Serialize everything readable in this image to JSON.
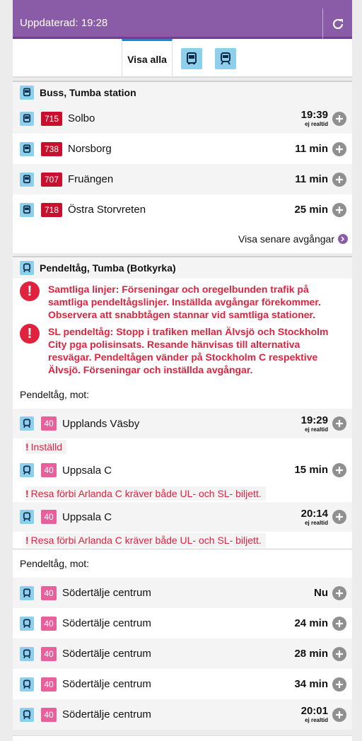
{
  "header": {
    "title": "Uppdaterad: 19:28"
  },
  "tabs": {
    "all_label": "Visa alla"
  },
  "bus_section": {
    "title": "Buss, Tumba station",
    "departures": [
      {
        "line": "715",
        "dest": "Solbo",
        "time": "19:39",
        "sub": "ej realtid"
      },
      {
        "line": "738",
        "dest": "Norsborg",
        "time": "11 min",
        "sub": ""
      },
      {
        "line": "707",
        "dest": "Fruängen",
        "time": "11 min",
        "sub": ""
      },
      {
        "line": "718",
        "dest": "Östra Storvreten",
        "time": "25 min",
        "sub": ""
      }
    ],
    "more_label": "Visa senare avgångar"
  },
  "train_section": {
    "title": "Pendeltåg, Tumba (Botkyrka)",
    "alerts": [
      "Samtliga linjer: Förseningar och oregelbunden trafik på samtliga pendeltågslinjer. Inställda avgångar förekommer. Observera att snabbtågen stannar vid samtliga stationer.",
      "SL pendeltåg: Stopp i trafiken mellan Älvsjö och Stockholm City pga polisinsats. Resande hänvisas till alternativa resvägar. Pendeltågen vänder på Stockholm C respektive Älvsjö. Förseningar och inställda avgångar."
    ],
    "group1_label": "Pendeltåg, mot:",
    "group1": [
      {
        "line": "40",
        "dest": "Upplands Väsby",
        "time": "19:29",
        "sub": "ej realtid",
        "note": "Inställd"
      },
      {
        "line": "40",
        "dest": "Uppsala C",
        "time": "15 min",
        "sub": "",
        "note": "Resa förbi Arlanda C kräver både UL- och SL- biljett."
      },
      {
        "line": "40",
        "dest": "Uppsala C",
        "time": "20:14",
        "sub": "ej realtid",
        "note": "Resa förbi Arlanda C kräver både UL- och SL- biljett."
      }
    ],
    "group2_label": "Pendeltåg, mot:",
    "group2": [
      {
        "line": "40",
        "dest": "Södertälje centrum",
        "time": "Nu",
        "sub": ""
      },
      {
        "line": "40",
        "dest": "Södertälje centrum",
        "time": "24 min",
        "sub": ""
      },
      {
        "line": "40",
        "dest": "Södertälje centrum",
        "time": "28 min",
        "sub": ""
      },
      {
        "line": "40",
        "dest": "Södertälje centrum",
        "time": "34 min",
        "sub": ""
      },
      {
        "line": "40",
        "dest": "Södertälje centrum",
        "time": "20:01",
        "sub": "ej realtid"
      }
    ]
  },
  "colors": {
    "header": "#8a5ba6",
    "bus_badge": "#c8102e",
    "train_badge": "#e8609b",
    "alert": "#e0223f",
    "mode_icon_bg": "#8ed0ec"
  }
}
